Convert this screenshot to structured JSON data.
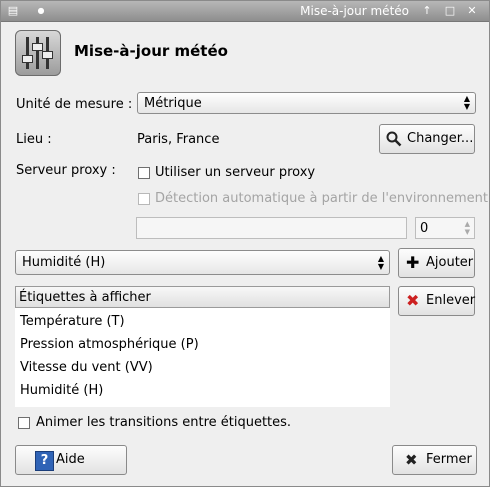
{
  "titlebar": {
    "title": "Mise-à-jour météo",
    "menu_glyph": "▤",
    "pin_glyph": "●",
    "shade_glyph": "↑",
    "maximize_glyph": "□",
    "close_glyph": "✕"
  },
  "header": {
    "title": "Mise-à-jour météo",
    "icon": "sliders-icon"
  },
  "units": {
    "label": "Unité de mesure :",
    "value": "Métrique"
  },
  "location": {
    "label": "Lieu :",
    "value": "Paris, France",
    "change_button": "Changer..."
  },
  "proxy": {
    "label": "Serveur proxy :",
    "use_proxy": "Utiliser un serveur proxy",
    "auto_detect": "Détection automatique à partir de l'environnement",
    "host_value": "",
    "port_value": "0"
  },
  "labels_select": {
    "value": "Humidité (H)",
    "add_button": "Ajouter",
    "remove_button": "Enlever"
  },
  "list": {
    "header": "Étiquettes à afficher",
    "items": [
      "Température (T)",
      "Pression atmosphérique (P)",
      "Vitesse du vent (VV)",
      "Humidité (H)"
    ]
  },
  "animate": {
    "label": "Animer les transitions entre étiquettes."
  },
  "footer": {
    "help_button": "Aide",
    "close_button": "Fermer"
  },
  "colors": {
    "accent_help": "#2f63b6",
    "remove_red": "#cc2020"
  }
}
